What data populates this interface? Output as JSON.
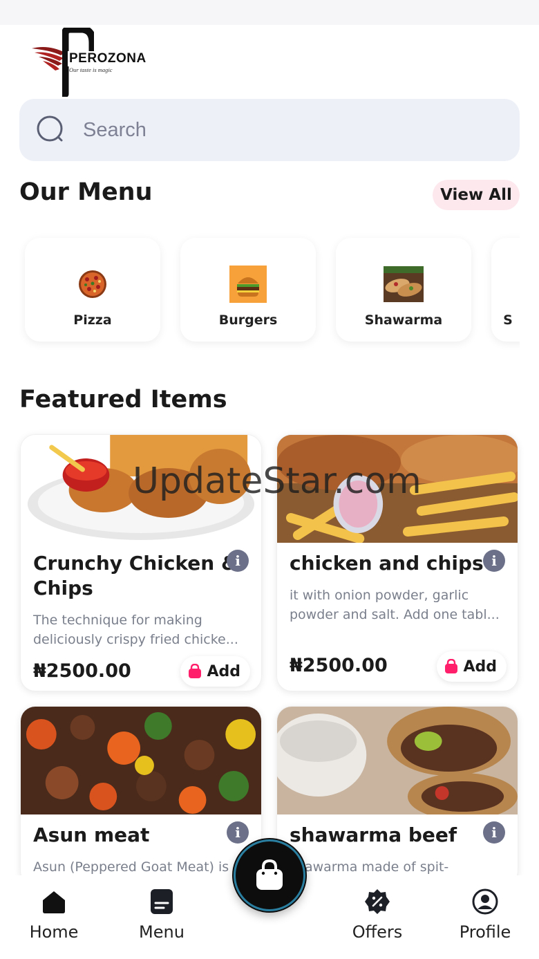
{
  "brand": {
    "name": "PEROZONA",
    "tagline": "Our taste is magic"
  },
  "search": {
    "placeholder": "Search",
    "icon": "search-icon"
  },
  "menu_section": {
    "title": "Our Menu",
    "view_all_label": "View All",
    "categories": [
      {
        "label": "Pizza",
        "icon": "pizza-image"
      },
      {
        "label": "Burgers",
        "icon": "burger-image"
      },
      {
        "label": "Shawarma",
        "icon": "shawarma-image"
      },
      {
        "label": "S",
        "icon": "category-image"
      }
    ]
  },
  "featured_section": {
    "title": "Featured Items",
    "items": [
      {
        "name_line1": "Crunchy Chicken &",
        "name_line2": "Chips",
        "desc_line1": "The technique for making",
        "desc_line2": "deliciously crispy fried chicke...",
        "price": "₦2500.00",
        "add_label": "Add"
      },
      {
        "name_line1": "chicken and chips",
        "desc_line1": "it with onion powder, garlic",
        "desc_line2": "powder and salt. Add one tabl...",
        "price": "₦2500.00",
        "add_label": "Add"
      },
      {
        "name_line1": "Asun meat",
        "desc_line1": "Asun (Peppered Goat Meat) is"
      },
      {
        "name_line1": "shawarma beef",
        "desc_line1": "shawarma made of spit-"
      }
    ]
  },
  "watermark": "UpdateStar.com",
  "tabbar": {
    "tabs": [
      {
        "label": "Home",
        "icon": "home-icon"
      },
      {
        "label": "Menu",
        "icon": "menu-icon"
      },
      {
        "label": "Offers",
        "icon": "offers-icon"
      },
      {
        "label": "Profile",
        "icon": "profile-icon"
      }
    ],
    "cart_icon": "shopping-bag-icon"
  },
  "colors": {
    "accent_pink": "#ff1f6b",
    "search_bg": "#eef0f8",
    "view_all_bg": "#fde8ee",
    "info_badge": "#6c7189",
    "fab_bg": "#0d0d0d"
  }
}
